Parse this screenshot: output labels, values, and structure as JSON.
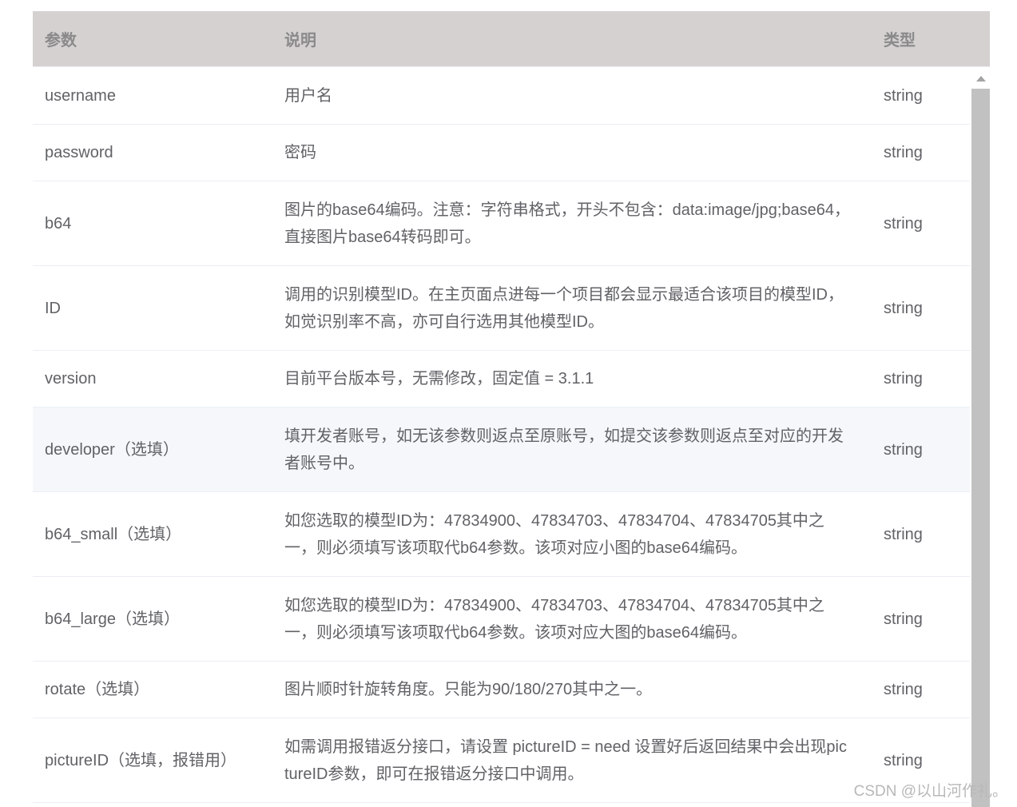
{
  "table": {
    "headers": {
      "param": "参数",
      "desc": "说明",
      "type": "类型"
    },
    "rows": [
      {
        "param": "username",
        "desc": "用户名",
        "type": "string"
      },
      {
        "param": "password",
        "desc": "密码",
        "type": "string"
      },
      {
        "param": "b64",
        "desc": "图片的base64编码。注意：字符串格式，开头不包含：data:image/jpg;base64，直接图片base64转码即可。",
        "type": "string"
      },
      {
        "param": "ID",
        "desc": "调用的识别模型ID。在主页面点进每一个项目都会显示最适合该项目的模型ID，如觉识别率不高，亦可自行选用其他模型ID。",
        "type": "string"
      },
      {
        "param": "version",
        "desc": "目前平台版本号，无需修改，固定值 = 3.1.1",
        "type": "string"
      },
      {
        "param": "developer（选填）",
        "desc": "填开发者账号，如无该参数则返点至原账号，如提交该参数则返点至对应的开发者账号中。",
        "type": "string"
      },
      {
        "param": "b64_small（选填）",
        "desc": "如您选取的模型ID为：47834900、47834703、47834704、47834705其中之一，则必须填写该项取代b64参数。该项对应小图的base64编码。",
        "type": "string"
      },
      {
        "param": "b64_large（选填）",
        "desc": "如您选取的模型ID为：47834900、47834703、47834704、47834705其中之一，则必须填写该项取代b64参数。该项对应大图的base64编码。",
        "type": "string"
      },
      {
        "param": "rotate（选填）",
        "desc": "图片顺时针旋转角度。只能为90/180/270其中之一。",
        "type": "string"
      },
      {
        "param": "pictureID（选填，报错用）",
        "desc": "如需调用报错返分接口，请设置 pictureID = need 设置好后返回结果中会出现pictureID参数，即可在报错返分接口中调用。",
        "type": "string"
      }
    ]
  },
  "watermark": "CSDN @以山河作礼。",
  "colors": {
    "header_bg": "#d6d1d1",
    "hover_row_bg": "#f5f7fa",
    "scroll_thumb": "#c1c1c1"
  }
}
